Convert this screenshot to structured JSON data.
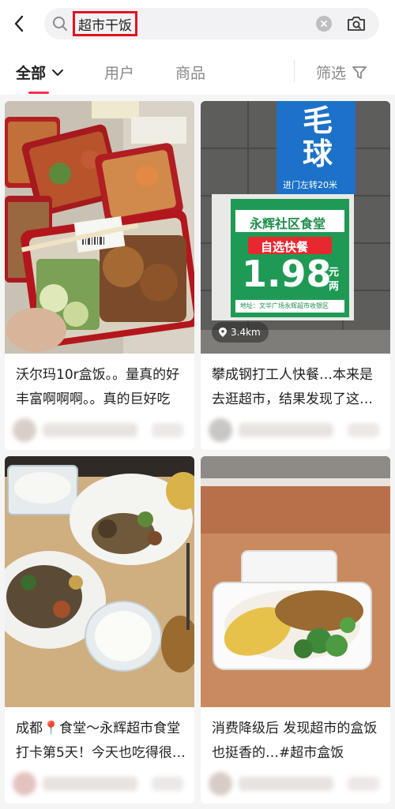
{
  "search": {
    "query": "超市干饭"
  },
  "tabs": [
    {
      "label": "全部",
      "active": true
    },
    {
      "label": "用户",
      "active": false
    },
    {
      "label": "商品",
      "active": false
    }
  ],
  "filter_label": "筛选",
  "colors": {
    "accent": "#ff2e4d",
    "highlight_box": "#e0141f",
    "feed_bg": "#f5f5f6"
  },
  "icons": [
    "back-arrow-icon",
    "search-icon",
    "clear-icon",
    "camera-search-icon",
    "chevron-down-icon",
    "filter-funnel-icon",
    "location-pin-icon"
  ],
  "cards": [
    {
      "title": "沃尔玛10r盒饭。。量真的好丰富啊啊啊。。真的巨好吃",
      "image": "walmart-boxed-meals"
    },
    {
      "title": "攀成钢打工人快餐…本来是去逛超市，结果发现了这家快餐",
      "image": "yonghui-canteen-sign",
      "location": "3.4km",
      "sign": {
        "top_big": "毛\n球",
        "top_small": "进门左转20米",
        "store": "永辉社区食堂",
        "promo": "自选快餐",
        "price": "1.98",
        "unit_top": "元",
        "unit_bottom": "两",
        "address": "地址：文华广场永辉超市收银区"
      }
    },
    {
      "title": "成都📍食堂～永辉超市食堂打卡第5天！今天也吃得很满足",
      "image": "canteen-table-plates"
    },
    {
      "title": "消费降级后 发现超市的盒饭也挺香的…#超市盒饭",
      "image": "takeout-box-egg-broccoli"
    }
  ]
}
